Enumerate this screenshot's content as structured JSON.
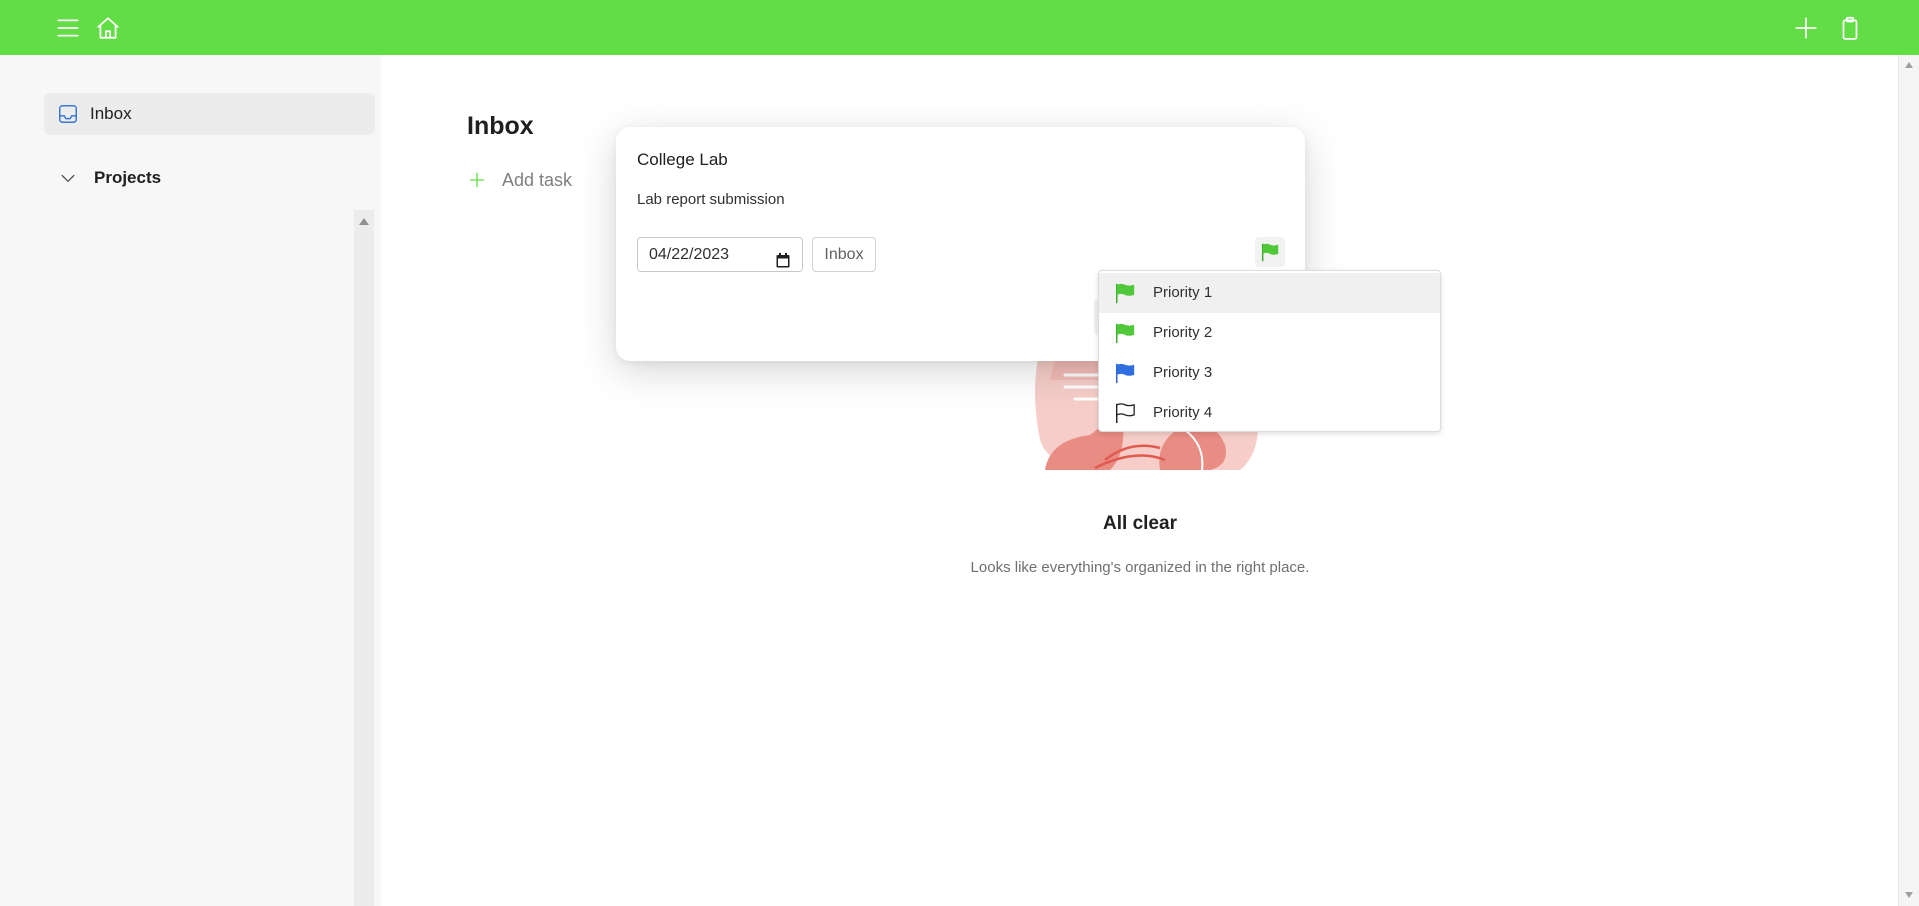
{
  "topbar": {
    "bg_color": "#62dd45",
    "left_icons": [
      "hamburger-menu-icon",
      "home-icon"
    ],
    "right_icons": [
      "plus-icon",
      "clipboard-icon"
    ]
  },
  "sidebar": {
    "inbox_label": "Inbox",
    "projects_label": "Projects"
  },
  "main": {
    "title": "Inbox",
    "add_task_label": "Add task",
    "empty_title": "All clear",
    "empty_subtitle": "Looks like everything's organized in the right place."
  },
  "editor": {
    "task_title": "College Lab",
    "task_description": "Lab report submission",
    "due_date": "04/22/2023",
    "project": "Inbox",
    "selected_priority_color": "#4fc93a"
  },
  "priority_menu": {
    "items": [
      {
        "label": "Priority 1",
        "color": "#4fc93a",
        "hovered": true
      },
      {
        "label": "Priority 2",
        "color": "#4fc93a",
        "hovered": false
      },
      {
        "label": "Priority 3",
        "color": "#2f6fe0",
        "hovered": false
      },
      {
        "label": "Priority 4",
        "color": "#ffffff",
        "hovered": false
      }
    ]
  }
}
